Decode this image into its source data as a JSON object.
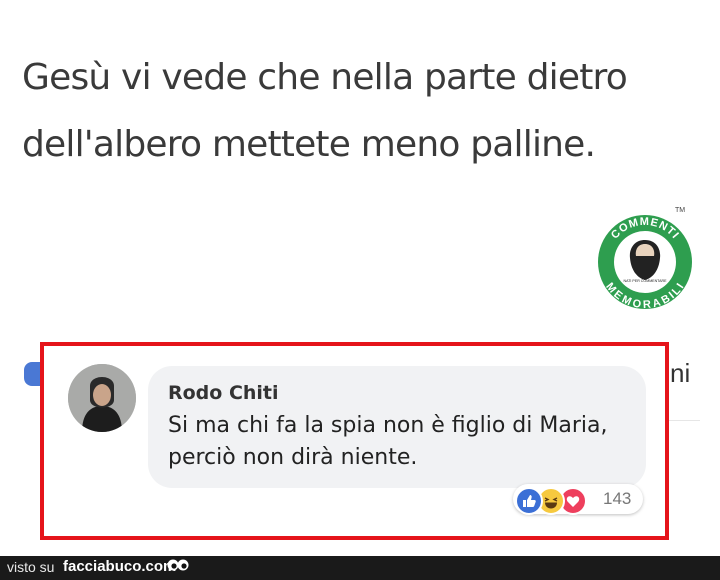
{
  "post": {
    "text": "Gesù vi vede che nella parte dietro dell'albero mettete meno palline."
  },
  "logo": {
    "text_top": "COMMENTI",
    "text_bottom": "MEMORABILI",
    "small_text": "NATI PER COMMENTARE",
    "trademark": "TM",
    "color": "#2e9e4f"
  },
  "background_ui": {
    "partial_text": "ni"
  },
  "comment": {
    "author": "Rodo Chiti",
    "text": "Si ma chi fa la spia non è figlio di Maria, perciò non dirà niente.",
    "reaction_count": "143",
    "reactions": [
      "like-icon",
      "haha-icon",
      "love-icon"
    ]
  },
  "highlight": {
    "border_color": "#e5141a"
  },
  "footer": {
    "visto_su": "visto su",
    "site": "facciabuco.com"
  }
}
